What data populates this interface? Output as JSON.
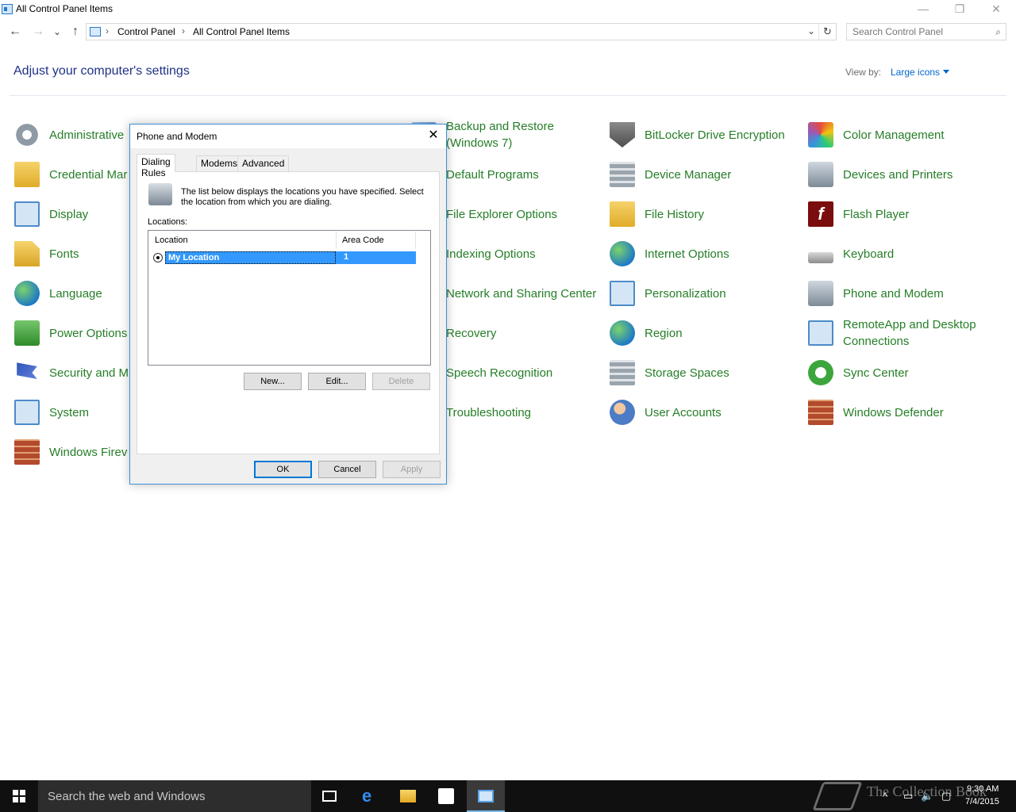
{
  "window": {
    "title": "All Control Panel Items",
    "minimize": "—",
    "restore": "❐",
    "close": "✕"
  },
  "nav": {
    "back": "←",
    "forward": "→",
    "recent": "⌄",
    "up": "↑",
    "breadcrumb": [
      "Control Panel",
      "All Control Panel Items"
    ],
    "separator": "›",
    "dropdown": "⌄",
    "refresh": "↻",
    "search_placeholder": "Search Control Panel"
  },
  "header": {
    "title": "Adjust your computer's settings",
    "view_by_label": "View by:",
    "view_by_value": "Large icons"
  },
  "items": {
    "col1": [
      "Administrative",
      "Credential Mar",
      "Display",
      "Fonts",
      "Language",
      "Power Options",
      "Security and M",
      "System",
      "Windows Firev"
    ],
    "col3": [
      "Backup and Restore (Windows 7)",
      "Default Programs",
      "File Explorer Options",
      "Indexing Options",
      "Network and Sharing Center",
      "Recovery",
      "Speech Recognition",
      "Troubleshooting"
    ],
    "col4": [
      "BitLocker Drive Encryption",
      "Device Manager",
      "File History",
      "Internet Options",
      "Personalization",
      "Region",
      "Storage Spaces",
      "User Accounts"
    ],
    "col5": [
      "Color Management",
      "Devices and Printers",
      "Flash Player",
      "Keyboard",
      "Phone and Modem",
      "RemoteApp and Desktop Connections",
      "Sync Center",
      "Windows Defender"
    ]
  },
  "dialog": {
    "title": "Phone and Modem",
    "close": "✕",
    "tabs": [
      "Dialing Rules",
      "Modems",
      "Advanced"
    ],
    "description": "The list below displays the locations you have specified. Select the location from which you are dialing.",
    "locations_label": "Locations:",
    "columns": [
      "Location",
      "Area Code"
    ],
    "rows": [
      {
        "location": "My Location",
        "area_code": "1"
      }
    ],
    "buttons": {
      "new": "New...",
      "edit": "Edit...",
      "delete": "Delete",
      "ok": "OK",
      "cancel": "Cancel",
      "apply": "Apply"
    }
  },
  "taskbar": {
    "search_text": "Search the web and Windows",
    "time": "9:30 AM",
    "date": "7/4/2015",
    "watermark": "The Collection Book"
  }
}
